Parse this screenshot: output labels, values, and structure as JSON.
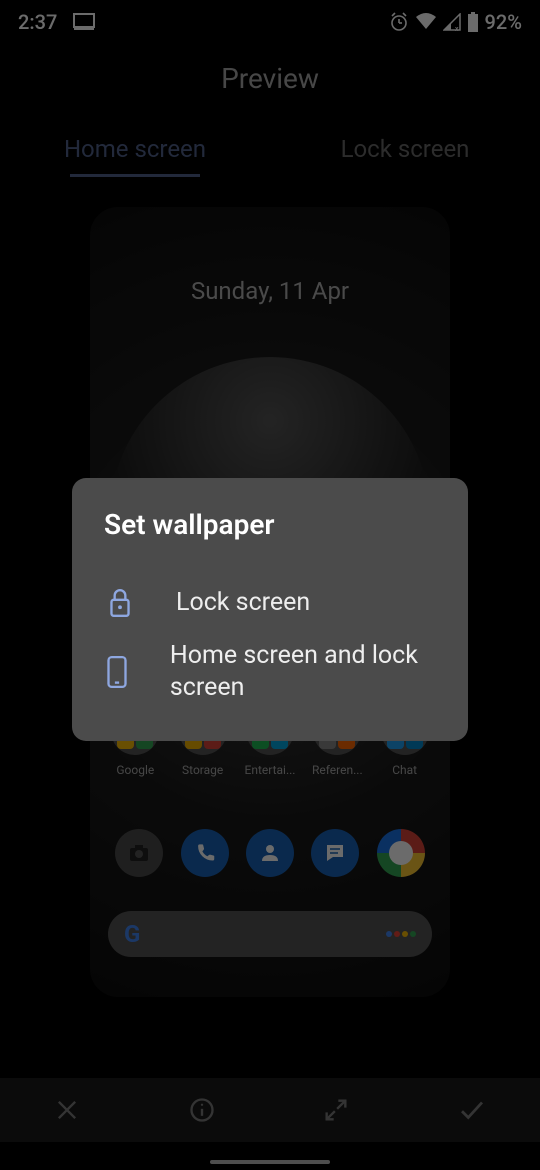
{
  "status": {
    "time": "2:37",
    "battery": "92%"
  },
  "header": {
    "title": "Preview"
  },
  "tabs": {
    "home": "Home screen",
    "lock": "Lock screen"
  },
  "preview": {
    "date": "Sunday, 11 Apr",
    "folders": [
      "Google",
      "Storage",
      "Entertai...",
      "Referen...",
      "Chat"
    ]
  },
  "dialog": {
    "title": "Set wallpaper",
    "options": [
      {
        "icon": "lock",
        "label": "Lock screen"
      },
      {
        "icon": "phone",
        "label": "Home screen and lock screen"
      }
    ]
  }
}
